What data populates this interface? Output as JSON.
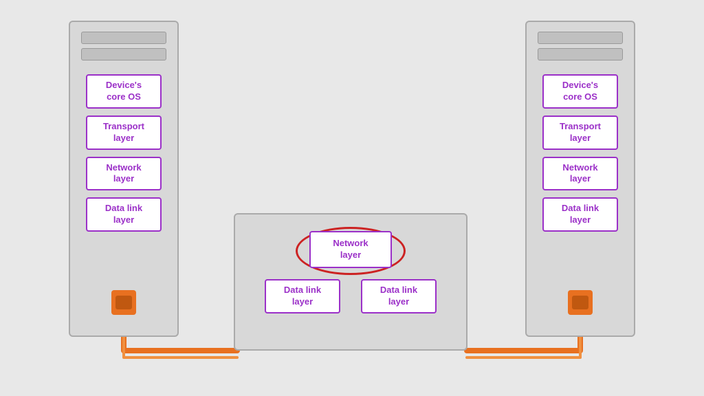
{
  "servers": {
    "left": {
      "layers": [
        {
          "label": "Device's\ncore OS"
        },
        {
          "label": "Transport\nlayer"
        },
        {
          "label": "Network\nlayer"
        },
        {
          "label": "Data link\nlayer"
        }
      ]
    },
    "right": {
      "layers": [
        {
          "label": "Device's\ncore OS"
        },
        {
          "label": "Transport\nlayer"
        },
        {
          "label": "Network\nlayer"
        },
        {
          "label": "Data link\nlayer"
        }
      ]
    }
  },
  "router": {
    "network_layer": "Network\nlayer",
    "bottom_layers": [
      "Data link\nlayer",
      "Data link\nlayer"
    ]
  },
  "colors": {
    "accent_purple": "#9b30c8",
    "cable_orange": "#e87020",
    "ellipse_red": "#cc2222",
    "server_bg": "#d8d8d8",
    "server_border": "#aaaaaa"
  }
}
